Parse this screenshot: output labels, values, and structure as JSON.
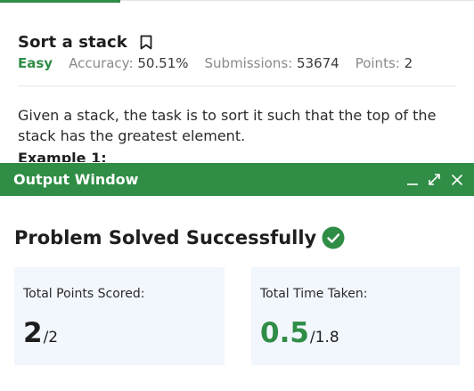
{
  "problem": {
    "title": "Sort a stack",
    "difficulty": "Easy",
    "accuracy_label": "Accuracy:",
    "accuracy_value": "50.51%",
    "submissions_label": "Submissions:",
    "submissions_value": "53674",
    "points_label": "Points:",
    "points_value": "2",
    "description": "Given a stack, the task is to sort it such that the top of the stack has the greatest element.",
    "example_heading": "Example 1:"
  },
  "output_window": {
    "title": "Output Window",
    "status": "Problem Solved Successfully",
    "points_card": {
      "label": "Total Points Scored:",
      "value": "2",
      "total": "/2"
    },
    "time_card": {
      "label": "Total Time Taken:",
      "value": "0.5",
      "total": "/1.8"
    }
  },
  "colors": {
    "brand_green": "#2f8d46",
    "card_bg": "#f2f6fd"
  },
  "icons": [
    "bookmark-icon",
    "minimize-icon",
    "expand-icon",
    "close-icon",
    "check-circle-icon"
  ]
}
